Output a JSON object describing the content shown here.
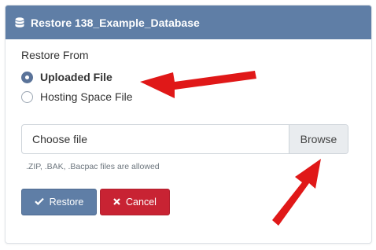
{
  "dialog": {
    "title": "Restore 138_Example_Database",
    "icon": "database-icon"
  },
  "restore_from": {
    "label": "Restore From",
    "options": [
      {
        "label": "Uploaded File",
        "checked": true
      },
      {
        "label": "Hosting Space File",
        "checked": false
      }
    ]
  },
  "file_input": {
    "placeholder": "Choose file",
    "browse_label": "Browse"
  },
  "hint": ".ZIP, .BAK, .Bacpac  files are allowed",
  "buttons": {
    "restore_label": "Restore",
    "cancel_label": "Cancel"
  },
  "colors": {
    "header": "#5f7ea6",
    "primary": "#5f7ea6",
    "danger": "#c82333",
    "annotation_arrow": "#e01818"
  }
}
